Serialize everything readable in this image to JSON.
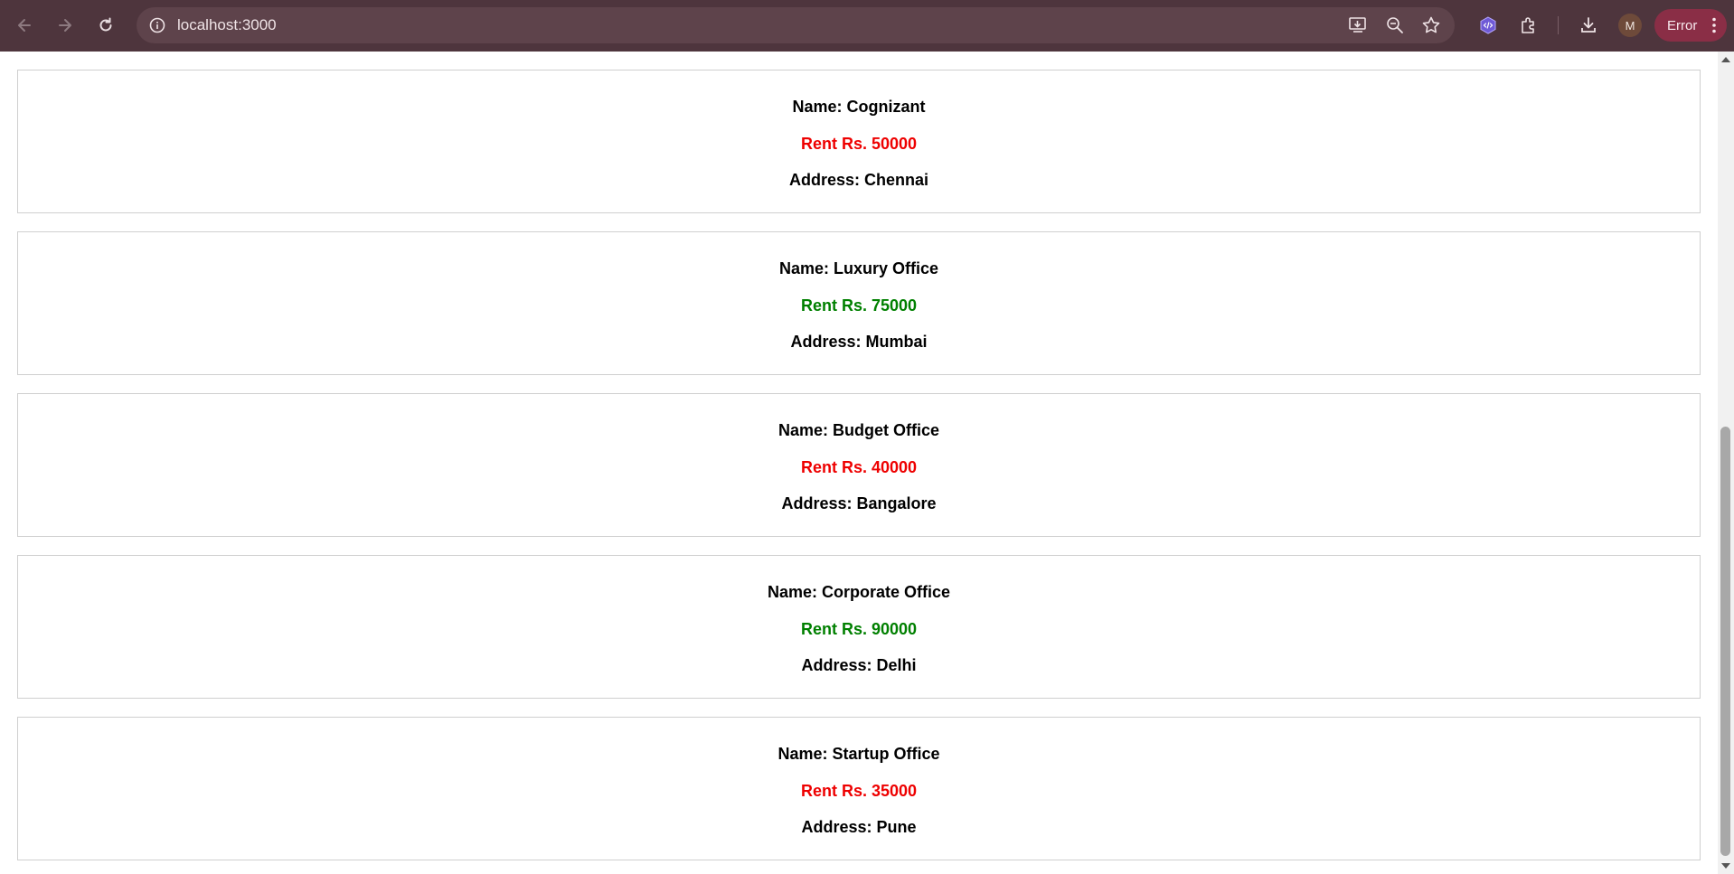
{
  "browser": {
    "url": "localhost:3000",
    "profile_initial": "M",
    "error_label": "Error"
  },
  "offices": [
    {
      "name": "Name: Cognizant",
      "rent": "Rent Rs. 50000",
      "address": "Address: Chennai",
      "rent_color": "red"
    },
    {
      "name": "Name: Luxury Office",
      "rent": "Rent Rs. 75000",
      "address": "Address: Mumbai",
      "rent_color": "green"
    },
    {
      "name": "Name: Budget Office",
      "rent": "Rent Rs. 40000",
      "address": "Address: Bangalore",
      "rent_color": "red"
    },
    {
      "name": "Name: Corporate Office",
      "rent": "Rent Rs. 90000",
      "address": "Address: Delhi",
      "rent_color": "green"
    },
    {
      "name": "Name: Startup Office",
      "rent": "Rent Rs. 35000",
      "address": "Address: Pune",
      "rent_color": "red"
    }
  ],
  "colors": {
    "toolbar_bg": "#4e353d",
    "rent_high": "#008000",
    "rent_low": "#ee0000"
  }
}
